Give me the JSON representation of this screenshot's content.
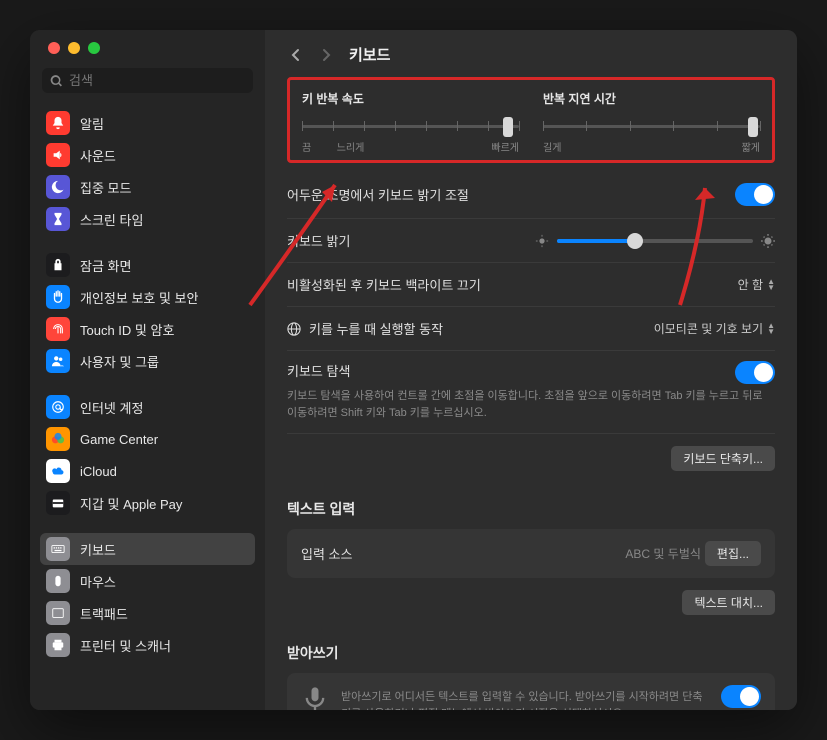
{
  "search": {
    "placeholder": "검색"
  },
  "sidebar": {
    "groups": [
      {
        "items": [
          {
            "label": "알림",
            "bg": "#ff3b30",
            "icon": "bell"
          },
          {
            "label": "사운드",
            "bg": "#ff3b30",
            "icon": "speaker"
          },
          {
            "label": "집중 모드",
            "bg": "#5856d6",
            "icon": "moon"
          },
          {
            "label": "스크린 타임",
            "bg": "#5856d6",
            "icon": "hourglass"
          }
        ]
      },
      {
        "items": [
          {
            "label": "잠금 화면",
            "bg": "#1c1c1e",
            "icon": "lock"
          },
          {
            "label": "개인정보 보호 및 보안",
            "bg": "#0a84ff",
            "icon": "hand"
          },
          {
            "label": "Touch ID 및 암호",
            "bg": "#ff453a",
            "icon": "fingerprint"
          },
          {
            "label": "사용자 및 그룹",
            "bg": "#0a84ff",
            "icon": "users"
          }
        ]
      },
      {
        "items": [
          {
            "label": "인터넷 계정",
            "bg": "#0a84ff",
            "icon": "at"
          },
          {
            "label": "Game Center",
            "bg": "#ff9500",
            "icon": "gamecenter"
          },
          {
            "label": "iCloud",
            "bg": "#ffffff",
            "icon": "icloud"
          },
          {
            "label": "지갑 및 Apple Pay",
            "bg": "#1c1c1e",
            "icon": "wallet"
          }
        ]
      },
      {
        "items": [
          {
            "label": "키보드",
            "bg": "#8e8e93",
            "icon": "keyboard",
            "selected": true
          },
          {
            "label": "마우스",
            "bg": "#8e8e93",
            "icon": "mouse"
          },
          {
            "label": "트랙패드",
            "bg": "#8e8e93",
            "icon": "trackpad"
          },
          {
            "label": "프린터 및 스캐너",
            "bg": "#8e8e93",
            "icon": "printer"
          }
        ]
      }
    ]
  },
  "header": {
    "title": "키보드"
  },
  "topSliders": {
    "repeat": {
      "title": "키 반복 속도",
      "min": "끔",
      "mid": "느리게",
      "max": "빠르게",
      "pos": 95
    },
    "delay": {
      "title": "반복 지연 시간",
      "min": "길게",
      "max": "짧게",
      "pos": 97
    }
  },
  "settings": {
    "autoBrightness": {
      "label": "어두운 조명에서 키보드 밝기 조절",
      "on": true
    },
    "brightness": {
      "label": "키보드 밝기",
      "pos": 40
    },
    "backlightOff": {
      "label": "비활성화된 후 키보드 백라이트 끄기",
      "value": "안 함"
    },
    "globeKey": {
      "label": "키를 누를 때 실행할 동작",
      "value": "이모티콘 및 기호 보기"
    },
    "navigation": {
      "label": "키보드 탐색",
      "desc": "키보드 탐색을 사용하여 컨트롤 간에 초점을 이동합니다. 초점을 앞으로 이동하려면 Tab 키를 누르고 뒤로 이동하려면 Shift 키와 Tab 키를 누르십시오.",
      "on": true
    },
    "shortcutsBtn": "키보드 단축키..."
  },
  "textInput": {
    "title": "텍스트 입력",
    "inputSource": {
      "label": "입력 소스",
      "value": "ABC 및 두벌식",
      "editBtn": "편집..."
    },
    "textReplaceBtn": "텍스트 대치..."
  },
  "dictation": {
    "title": "받아쓰기",
    "desc": "받아쓰기로 어디서든 텍스트를 입력할 수 있습니다. 받아쓰기를 시작하려면 단축키를 사용하거나 편집 메뉴에서 받아쓰기 시작을 선택하십시오.",
    "on": true
  }
}
